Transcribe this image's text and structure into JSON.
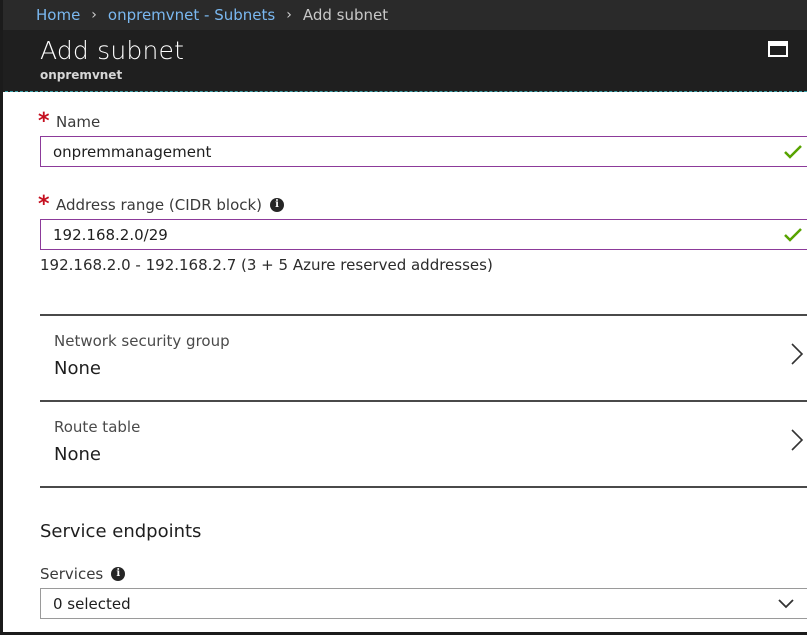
{
  "breadcrumb": {
    "home": "Home",
    "separator": "›",
    "parent": "onpremvnet - Subnets",
    "current": "Add subnet"
  },
  "blade": {
    "title": "Add subnet",
    "subtitle": "onpremvnet"
  },
  "form": {
    "name": {
      "required_marker": "*",
      "label": "Name",
      "value": "onpremmanagement",
      "valid": true
    },
    "address_range": {
      "required_marker": "*",
      "label": "Address range (CIDR block)",
      "value": "192.168.2.0/29",
      "valid": true,
      "hint": "192.168.2.0 - 192.168.2.7 (3 + 5 Azure reserved addresses)"
    },
    "network_security_group": {
      "label": "Network security group",
      "value": "None"
    },
    "route_table": {
      "label": "Route table",
      "value": "None"
    },
    "service_endpoints": {
      "section_title": "Service endpoints",
      "services_label": "Services",
      "selected": "0 selected"
    }
  },
  "icons": {
    "info": "info-icon",
    "check": "checkmark-icon",
    "chevron_right": "chevron-right-icon",
    "chevron_down": "chevron-down-icon",
    "maximize": "maximize-icon",
    "info_glyph": "i"
  },
  "colors": {
    "header_bg": "#1f1f1f",
    "link": "#7ab8f0",
    "valid_check": "#57a300",
    "required": "#c50f1f",
    "input_border_focus": "#8c3a9a"
  }
}
